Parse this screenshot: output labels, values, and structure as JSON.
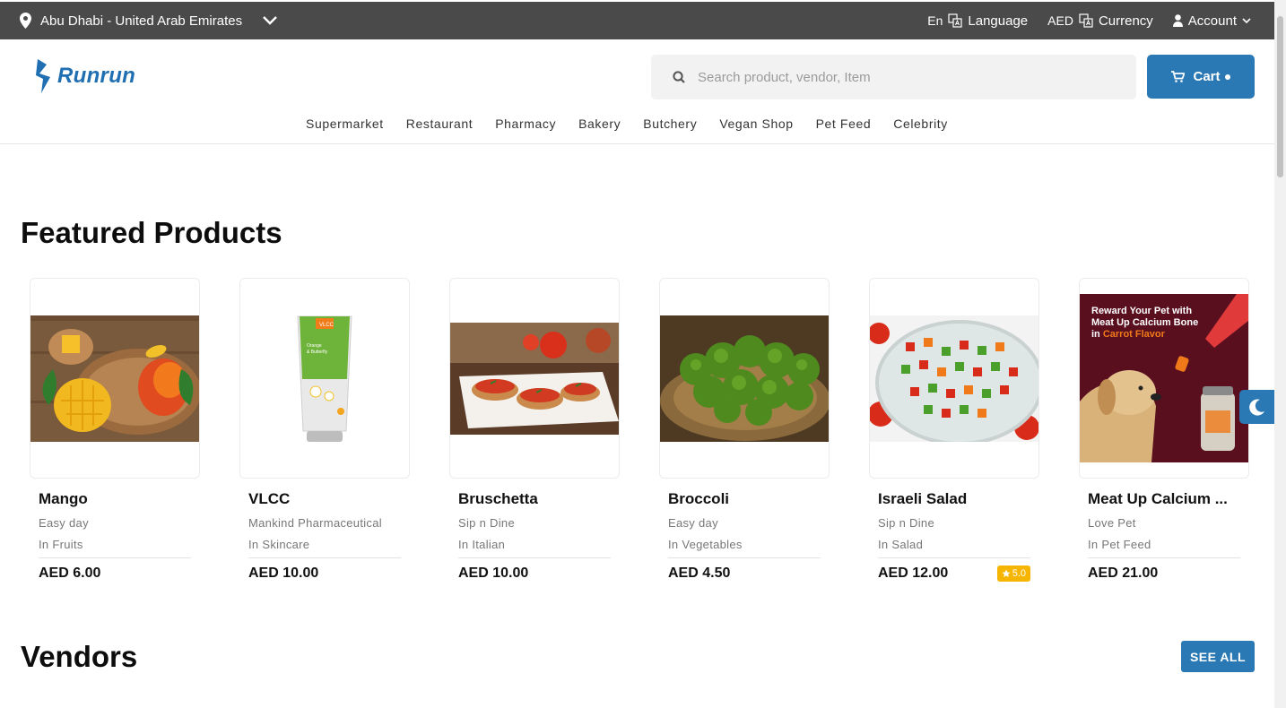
{
  "topbar": {
    "location": "Abu Dhabi - United Arab Emirates",
    "lang_code": "En",
    "language_label": "Language",
    "currency_code": "AED",
    "currency_label": "Currency",
    "account_label": "Account"
  },
  "header": {
    "logo_text": "Runrun",
    "search_placeholder": "Search product, vendor, Item",
    "cart_label": "Cart"
  },
  "nav": [
    "Supermarket",
    "Restaurant",
    "Pharmacy",
    "Bakery",
    "Butchery",
    "Vegan Shop",
    "Pet Feed",
    "Celebrity"
  ],
  "featured": {
    "title": "Featured Products",
    "products": [
      {
        "name": "Mango",
        "vendor": "Easy day",
        "category": "In Fruits",
        "price": "AED 6.00",
        "rating": null
      },
      {
        "name": "VLCC",
        "vendor": "Mankind Pharmaceutical",
        "category": "In Skincare",
        "price": "AED 10.00",
        "rating": null
      },
      {
        "name": "Bruschetta",
        "vendor": "Sip n Dine",
        "category": "In Italian",
        "price": "AED 10.00",
        "rating": null
      },
      {
        "name": "Broccoli",
        "vendor": "Easy day",
        "category": "In Vegetables",
        "price": "AED 4.50",
        "rating": null
      },
      {
        "name": "Israeli Salad",
        "vendor": "Sip n Dine",
        "category": "In Salad",
        "price": "AED 12.00",
        "rating": "5.0"
      },
      {
        "name": "Meat Up Calcium ...",
        "vendor": "Love Pet",
        "category": "In Pet Feed",
        "price": "AED 21.00",
        "rating": null
      }
    ],
    "pet_banner": {
      "line1": "Reward Your Pet with",
      "line2": "Meat Up Calcium Bone",
      "line3_prefix": "in ",
      "line3_highlight": "Carrot Flavor"
    }
  },
  "vendors": {
    "title": "Vendors",
    "see_all": "SEE ALL"
  },
  "colors": {
    "accent": "#2a79b5",
    "topbar": "#4a4a4a",
    "rating": "#f6b500"
  }
}
